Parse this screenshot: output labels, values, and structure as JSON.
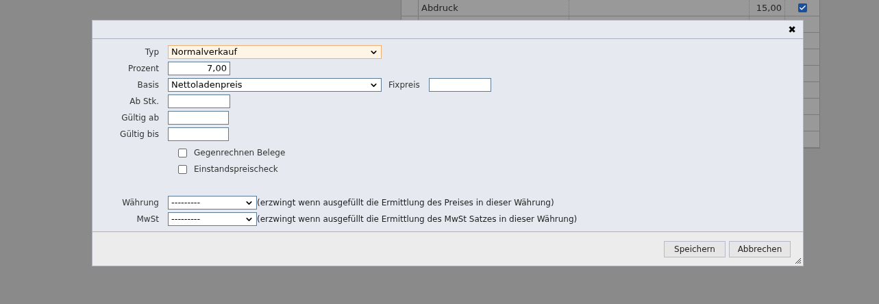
{
  "background_table": {
    "rows": [
      {
        "name": "Abdruck",
        "value": "15,00",
        "checked": true
      },
      {},
      {},
      {},
      {},
      {},
      {},
      {},
      {}
    ]
  },
  "dialog": {
    "close": "✖",
    "fields": [
      {
        "kind": "select",
        "label": "Typ",
        "value": "Normalverkauf",
        "highlighted": true
      },
      {
        "kind": "number",
        "label": "Prozent",
        "value": "7,00"
      },
      {
        "kind": "select",
        "label": "Basis",
        "value": "Nettoladenpreis",
        "extra_label": "Fixpreis"
      },
      {
        "kind": "text",
        "label": "Ab Stk."
      },
      {
        "kind": "text",
        "label": "Gültig ab"
      },
      {
        "kind": "text",
        "label": "Gültig bis"
      }
    ],
    "checkboxes": [
      {
        "label": "Gegenrechnen Belege",
        "checked": false
      },
      {
        "label": "Einstandspreischeck",
        "checked": false
      }
    ],
    "selects": [
      {
        "label": "Währung",
        "value": "---------",
        "hint": "(erzwingt wenn ausgefüllt die Ermittlung des Preises in dieser Währung)"
      },
      {
        "label": "MwSt",
        "value": "---------",
        "hint": "(erzwingt wenn ausgefüllt die Ermittlung des MwSt Satzes in dieser Währung)"
      }
    ],
    "buttons": [
      "Speichern",
      "Abbrechen"
    ]
  }
}
